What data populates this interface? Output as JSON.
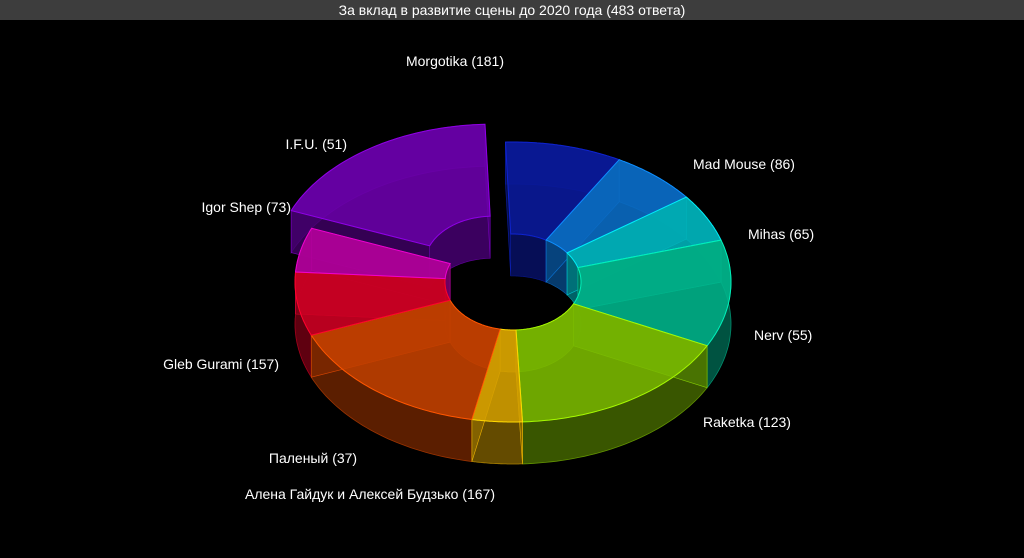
{
  "title": "За вклад в развитие сцены до 2020 года (483 ответа)",
  "chart_data": {
    "type": "pie",
    "variant": "3d-donut",
    "title": "За вклад в развитие сцены до 2020 года (483 ответа)",
    "total_responses": 483,
    "slices": [
      {
        "label": "Morgotika",
        "value": 181,
        "display": "Morgotika (181)",
        "color": "#6a00aa"
      },
      {
        "label": "Mad Mouse",
        "value": 86,
        "display": "Mad Mouse (86)",
        "color": "#0a1a9a"
      },
      {
        "label": "Mihas",
        "value": 65,
        "display": "Mihas (65)",
        "color": "#0a6ac2"
      },
      {
        "label": "Nerv",
        "value": 55,
        "display": "Nerv (55)",
        "color": "#00b0b8"
      },
      {
        "label": "Raketka",
        "value": 123,
        "display": "Raketka (123)",
        "color": "#00b28a"
      },
      {
        "label": "Алена Гайдук и Алексей Будзько",
        "value": 167,
        "display": "Алена Гайдук и Алексей Будзько (167)",
        "color": "#7ab800"
      },
      {
        "label": "Паленый",
        "value": 37,
        "display": "Паленый (37)",
        "color": "#d4a000"
      },
      {
        "label": "Gleb Gurami",
        "value": 157,
        "display": "Gleb Gurami (157)",
        "color": "#c24000"
      },
      {
        "label": "Igor Shep",
        "value": 73,
        "display": "Igor Shep (73)",
        "color": "#cc0022"
      },
      {
        "label": "I.F.U.",
        "value": 51,
        "display": "I.F.U. (51)",
        "color": "#b0009a"
      }
    ],
    "exploded": [
      "Morgotika"
    ],
    "legend": "none"
  }
}
